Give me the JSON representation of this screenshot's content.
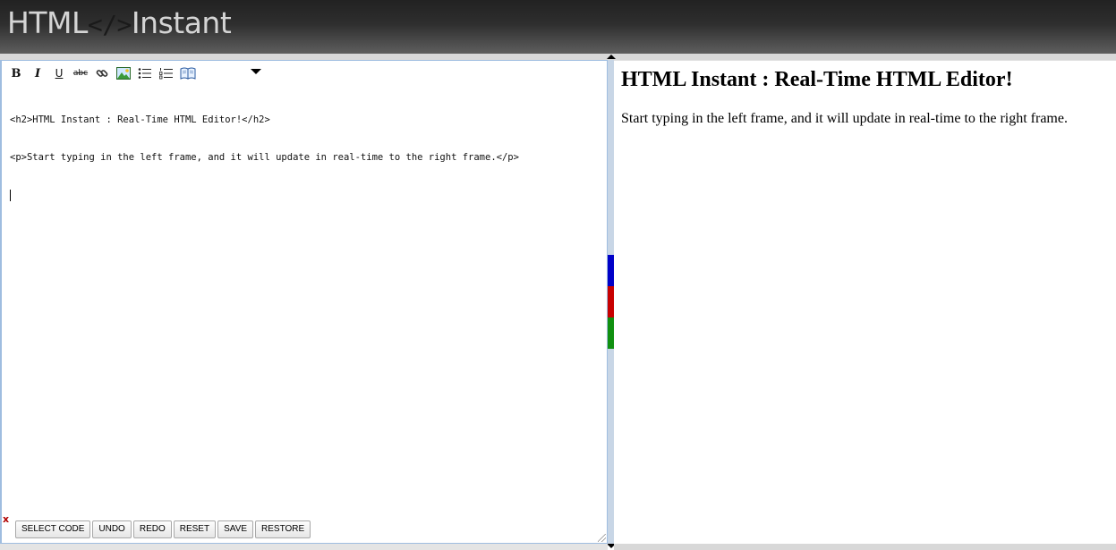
{
  "header": {
    "logo_part1": "HTML",
    "logo_part2": "</>",
    "logo_part3": "Instant"
  },
  "toolbar": {
    "bold": "B",
    "italic": "I",
    "underline": "U",
    "strike": "abc",
    "icons": [
      "bold-icon",
      "italic-icon",
      "underline-icon",
      "strikethrough-icon",
      "link-icon",
      "image-icon",
      "bullet-list-icon",
      "numbered-list-icon",
      "book-icon",
      "dropdown-icon"
    ]
  },
  "editor": {
    "lines": [
      "<h2>HTML Instant : Real-Time HTML Editor!</h2>",
      "<p>Start typing in the left frame, and it will update in real-time to the right frame.</p>"
    ],
    "close_label": "x",
    "buttons": [
      "SELECT CODE",
      "UNDO",
      "REDO",
      "RESET",
      "SAVE",
      "RESTORE"
    ]
  },
  "preview": {
    "heading": "HTML Instant : Real-Time HTML Editor!",
    "paragraph": "Start typing in the left frame, and it will update in real-time to the right frame."
  },
  "splitter": {
    "swatch_colors": [
      "#0000c8",
      "#c80000",
      "#109010"
    ]
  }
}
